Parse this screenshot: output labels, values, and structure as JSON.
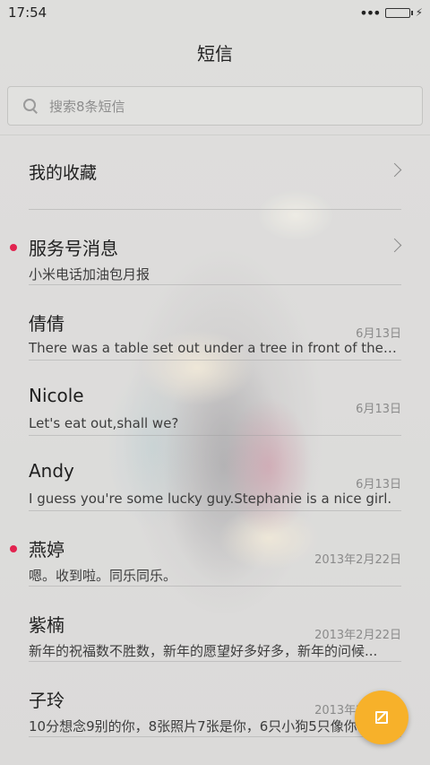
{
  "status_bar": {
    "time": "17:54",
    "signal_dots": "•••",
    "battery_color": "#3fd21d"
  },
  "header": {
    "title": "短信"
  },
  "search": {
    "placeholder": "搜索8条短信"
  },
  "conversations": [
    {
      "name": "我的收藏",
      "preview": "",
      "date": "",
      "unread": false,
      "chevron": true
    },
    {
      "name": "服务号消息",
      "preview": "小米电话加油包月报",
      "date": "",
      "unread": true,
      "chevron": true
    },
    {
      "name": "倩倩",
      "preview": "There was a table set out under a tree in front of the ho...",
      "date": "6月13日",
      "unread": false,
      "chevron": false
    },
    {
      "name": "Nicole",
      "preview": "Let's eat out,shall we?",
      "date": "6月13日",
      "unread": false,
      "chevron": false
    },
    {
      "name": "Andy",
      "preview": "I guess you're some lucky guy.Stephanie is a nice girl.",
      "date": "6月13日",
      "unread": false,
      "chevron": false
    },
    {
      "name": "燕婷",
      "preview": "嗯。收到啦。同乐同乐。",
      "date": "2013年2月22日",
      "unread": true,
      "chevron": false
    },
    {
      "name": "紫楠",
      "preview": "新年的祝福数不胜数，新年的愿望好多好多，新年的问候...",
      "date": "2013年2月22日",
      "unread": false,
      "chevron": false
    },
    {
      "name": "子玲",
      "preview": "10分想念9别的你，8张照片7张是你，6只小狗5只像你...",
      "date": "2013年2月22日",
      "unread": false,
      "chevron": false
    }
  ],
  "fab": {
    "icon": "compose-icon",
    "color": "#f7b12a"
  },
  "colors": {
    "unread_dot": "#e2234f"
  }
}
